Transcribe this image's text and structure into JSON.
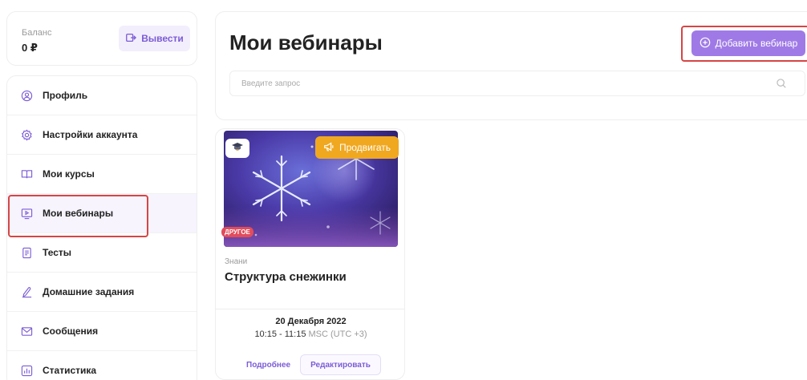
{
  "balance": {
    "label": "Баланс",
    "amount": "0 ₽",
    "withdraw_label": "Вывести"
  },
  "sidebar": {
    "items": [
      {
        "label": "Профиль",
        "icon": "user-icon"
      },
      {
        "label": "Настройки аккаунта",
        "icon": "gear-icon"
      },
      {
        "label": "Мои курсы",
        "icon": "book-icon"
      },
      {
        "label": "Мои вебинары",
        "icon": "video-icon",
        "active": true
      },
      {
        "label": "Тесты",
        "icon": "document-icon"
      },
      {
        "label": "Домашние задания",
        "icon": "pen-icon"
      },
      {
        "label": "Сообщения",
        "icon": "mail-icon"
      },
      {
        "label": "Статистика",
        "icon": "chart-icon"
      }
    ]
  },
  "header": {
    "title": "Мои вебинары",
    "add_label": "Добавить вебинар"
  },
  "search": {
    "placeholder": "Введите запрос",
    "value": ""
  },
  "webinar": {
    "promote_label": "Продвигать",
    "category": "ДРУГОЕ",
    "organizer": "Знани",
    "title": "Структура снежинки",
    "date": "20 Декабря 2022",
    "time": "10:15 - 11:15",
    "timezone": "MSC (UTC +3)",
    "more_label": "Подробнее",
    "edit_label": "Редактировать"
  },
  "colors": {
    "accent": "#9f7ae6",
    "promo": "#f0a820",
    "highlight": "#d64545",
    "tag": "#e24c5b"
  }
}
